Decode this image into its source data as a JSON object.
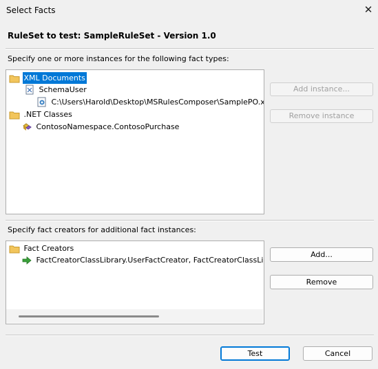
{
  "window": {
    "title": "Select Facts",
    "close_glyph": "✕"
  },
  "header": {
    "ruleset_label": "RuleSet to test: SampleRuleSet - Version 1.0"
  },
  "instances_section": {
    "label": "Specify one or more instances for the following fact types:",
    "tree": [
      {
        "label": "XML Documents",
        "icon": "folder-icon",
        "selected": true
      },
      {
        "label": "SchemaUser",
        "icon": "xml-schema-icon"
      },
      {
        "label": "C:\\Users\\Harold\\Desktop\\MSRulesComposer\\SamplePO.xml",
        "icon": "xml-file-icon"
      },
      {
        "label": ".NET Classes",
        "icon": "folder-icon"
      },
      {
        "label": "ContosoNamespace.ContosoPurchase",
        "icon": "class-icon"
      }
    ],
    "add_button": "Add instance...",
    "remove_button": "Remove instance"
  },
  "creators_section": {
    "label": "Specify fact creators for additional fact instances:",
    "tree": [
      {
        "label": "Fact Creators",
        "icon": "folder-icon"
      },
      {
        "label": "FactCreatorClassLibrary.UserFactCreator, FactCreatorClassLibrary, Ver",
        "icon": "arrow-right-icon"
      }
    ],
    "add_button": "Add...",
    "remove_button": "Remove"
  },
  "footer": {
    "test_button": "Test",
    "cancel_button": "Cancel"
  },
  "colors": {
    "selection": "#0078d7",
    "folder": "#f2c55c",
    "arrow": "#3aa03a"
  }
}
